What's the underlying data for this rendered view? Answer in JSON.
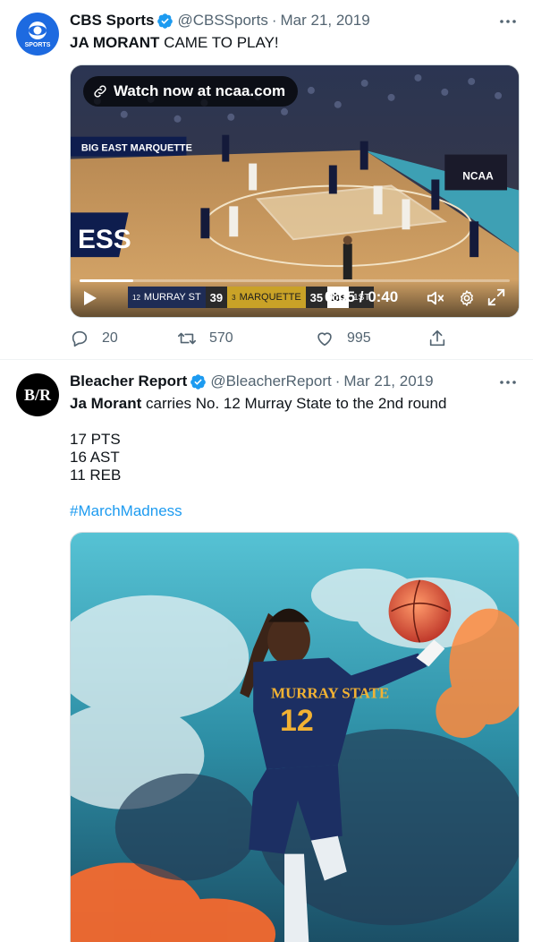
{
  "tweets": [
    {
      "author": "CBS Sports",
      "handle": "@CBSSports",
      "date": "Mar 21, 2019",
      "avatar_text": "SPORTS",
      "text_bold": "JA MORANT",
      "text_rest": " CAME TO PLAY!",
      "video": {
        "watch_label": "Watch now at ncaa.com",
        "time": "0:05 / 0:40",
        "progress": 0.125,
        "scorebug": {
          "team1_seed": "12",
          "team1": "MURRAY ST",
          "team1_score": "39",
          "team2_seed": "3",
          "team2": "MARQUETTE",
          "team2_score": "35",
          "network": "tbs",
          "period": "1ST"
        },
        "court_text": "BIG EAST MARQUETTE",
        "court_big": "ESS"
      },
      "replies": "20",
      "retweets": "570",
      "likes": "995"
    },
    {
      "author": "Bleacher Report",
      "handle": "@BleacherReport",
      "date": "Mar 21, 2019",
      "avatar_text": "B/R",
      "text_bold": "Ja Morant",
      "text_rest": " carries No. 12 Murray State to the 2nd round",
      "stats": [
        "17 PTS",
        "16 AST",
        "11 REB"
      ],
      "hashtag": "#MarchMadness",
      "jersey_text": "MURRAY STATE",
      "jersey_number": "12"
    }
  ],
  "colors": {
    "accent": "#1d9bf0",
    "text": "#0f1419",
    "muted": "#536471",
    "cbs_blue": "#1d6ae0"
  }
}
